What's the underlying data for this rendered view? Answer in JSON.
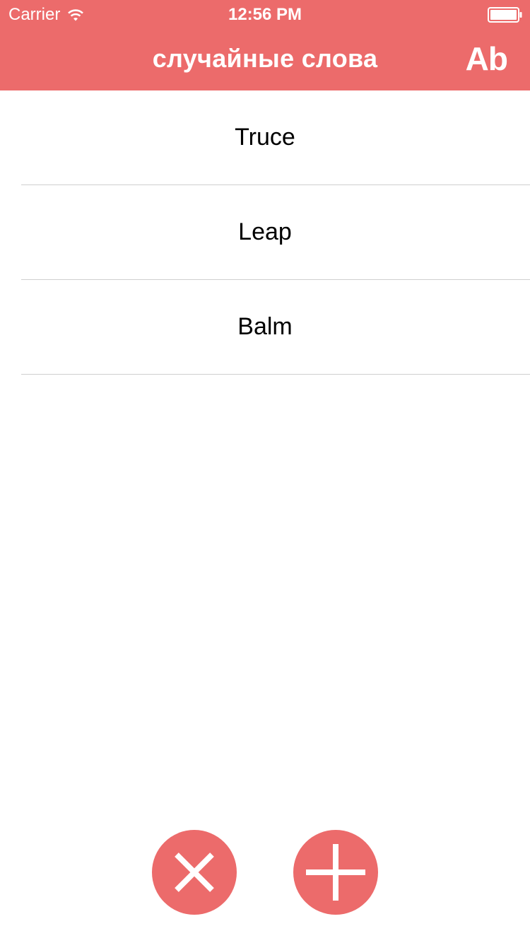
{
  "status_bar": {
    "carrier": "Carrier",
    "time": "12:56 PM",
    "wifi_icon": "wifi-icon",
    "battery_icon": "battery-icon"
  },
  "nav": {
    "title": "случайные слова",
    "font_button_label": "Ab"
  },
  "words": [
    {
      "text": "Truce"
    },
    {
      "text": "Leap"
    },
    {
      "text": "Balm"
    }
  ],
  "actions": {
    "remove_icon": "close-icon",
    "add_icon": "plus-icon"
  },
  "colors": {
    "accent": "#EC6B6B",
    "text": "#000000",
    "separator": "#cfcfcf",
    "background": "#ffffff"
  }
}
